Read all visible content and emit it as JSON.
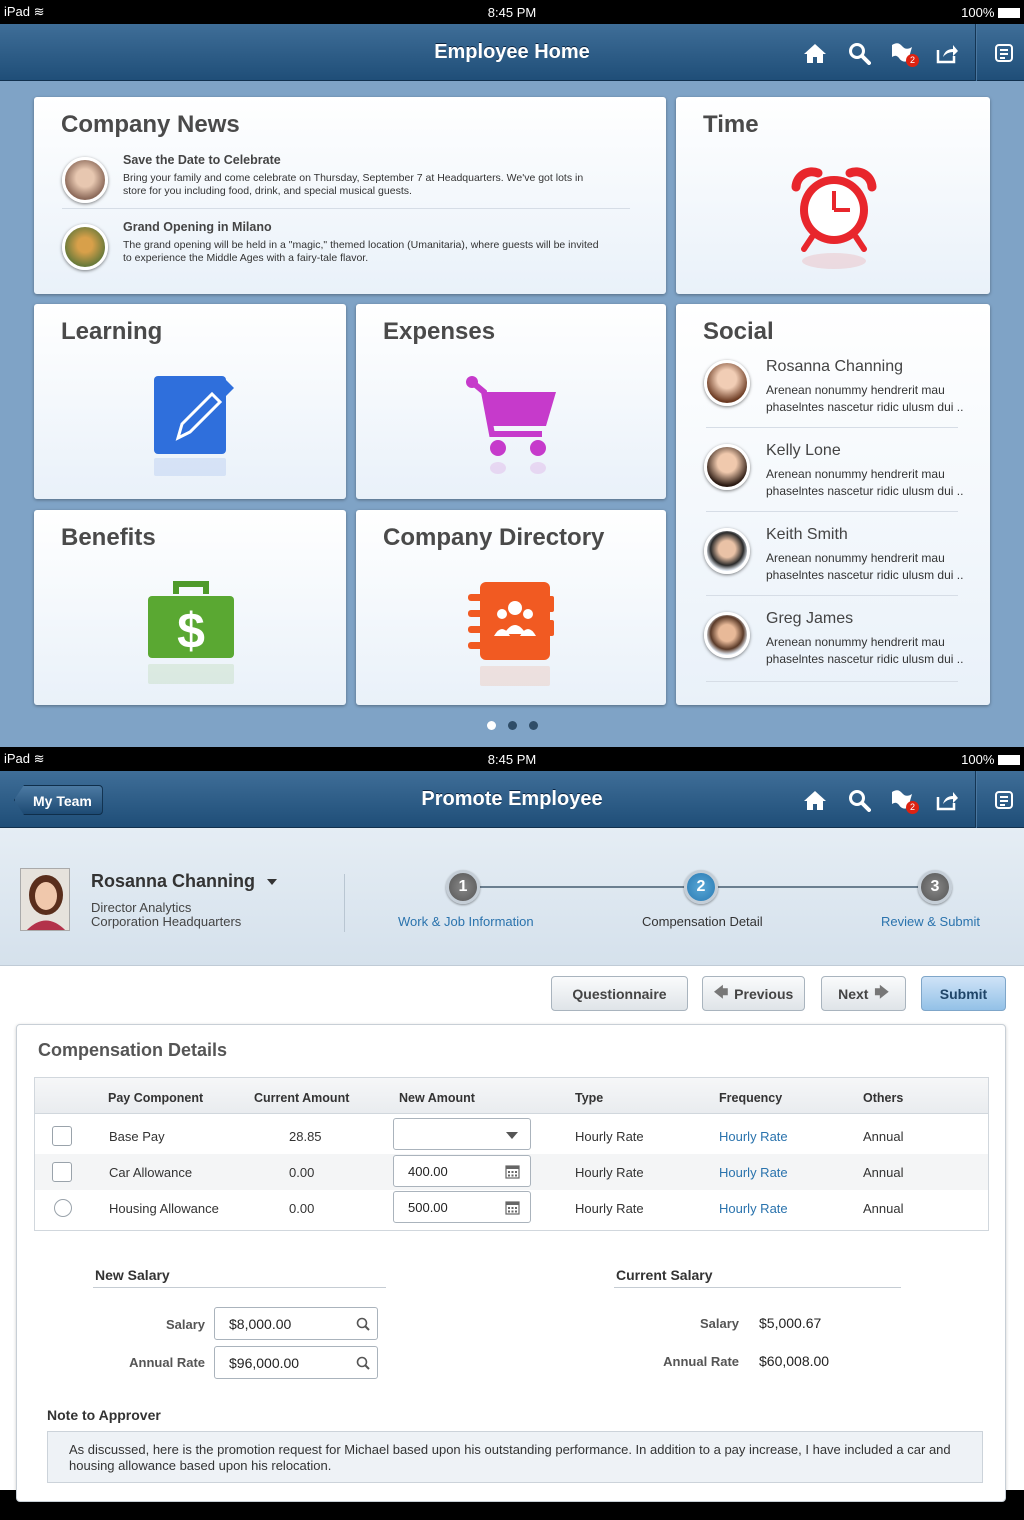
{
  "screen1": {
    "status": {
      "device": "iPad",
      "time": "8:45 PM",
      "battery": "100%"
    },
    "nav_title": "Employee Home",
    "notification_count": "2",
    "news": {
      "title": "Company News",
      "items": [
        {
          "title": "Save the Date to Celebrate",
          "body": "Bring your family and come celebrate on Thursday, September 7 at Headquarters. We've got lots in store for you including food, drink, and special musical guests."
        },
        {
          "title": "Grand Opening in Milano",
          "body": "The grand opening will be held in a \"magic,\" themed location (Umanitaria), where guests will be invited to experience the Middle Ages with a fairy-tale flavor."
        }
      ]
    },
    "time_title": "Time",
    "learning_title": "Learning",
    "expenses_title": "Expenses",
    "benefits_title": "Benefits",
    "directory_title": "Company Directory",
    "social": {
      "title": "Social",
      "items": [
        {
          "name": "Rosanna Channing",
          "text": "Arenean nonummy hendrerit mau phaselntes nascetur ridic ulusm dui .."
        },
        {
          "name": "Kelly Lone",
          "text": "Arenean nonummy hendrerit mau phaselntes nascetur ridic ulusm dui .."
        },
        {
          "name": "Keith Smith",
          "text": "Arenean nonummy hendrerit mau phaselntes nascetur ridic ulusm dui .."
        },
        {
          "name": "Greg James",
          "text": "Arenean nonummy hendrerit mau phaselntes nascetur ridic ulusm dui .."
        }
      ]
    },
    "page_dots": {
      "count": 3,
      "active": 1
    }
  },
  "screen2": {
    "status": {
      "device": "iPad",
      "time": "8:45 PM",
      "battery": "100%"
    },
    "nav_title": "Promote Employee",
    "back_label": "My Team",
    "notification_count": "2",
    "employee": {
      "name": "Rosanna Channing",
      "title": "Director Analytics",
      "location": "Corporation Headquarters"
    },
    "steps": [
      {
        "num": "1",
        "label": "Work & Job Information"
      },
      {
        "num": "2",
        "label": "Compensation Detail"
      },
      {
        "num": "3",
        "label": "Review & Submit"
      }
    ],
    "buttons": {
      "questionnaire": "Questionnaire",
      "previous": "Previous",
      "next": "Next",
      "submit": "Submit"
    },
    "panel_title": "Compensation Details",
    "table": {
      "headers": [
        "Pay Component",
        "Current Amount",
        "New Amount",
        "Type",
        "Frequency",
        "Others"
      ],
      "rows": [
        {
          "component": "Base Pay",
          "current": "28.85",
          "new_amount": "",
          "type": "Hourly Rate",
          "frequency": "Hourly Rate",
          "others": "Annual"
        },
        {
          "component": "Car Allowance",
          "current": "0.00",
          "new_amount": "400.00",
          "type": "Hourly Rate",
          "frequency": "Hourly Rate",
          "others": "Annual"
        },
        {
          "component": "Housing Allowance",
          "current": "0.00",
          "new_amount": "500.00",
          "type": "Hourly Rate",
          "frequency": "Hourly Rate",
          "others": "Annual"
        }
      ]
    },
    "new_salary": {
      "heading": "New Salary",
      "salary_label": "Salary",
      "salary_value": "$8,000.00",
      "annual_label": "Annual Rate",
      "annual_value": "$96,000.00"
    },
    "current_salary": {
      "heading": "Current Salary",
      "salary_label": "Salary",
      "salary_value": "$5,000.67",
      "annual_label": "Annual Rate",
      "annual_value": "$60,008.00"
    },
    "note": {
      "label": "Note to Approver",
      "text": "As discussed, here is the promotion request for Michael based upon his outstanding performance. In addition to a pay increase, I have included a car and housing allowance based upon his relocation."
    },
    "colors": {
      "nav": "#1f4e78",
      "accent": "#2a73ad",
      "step_active": "#2a7ab3"
    }
  }
}
